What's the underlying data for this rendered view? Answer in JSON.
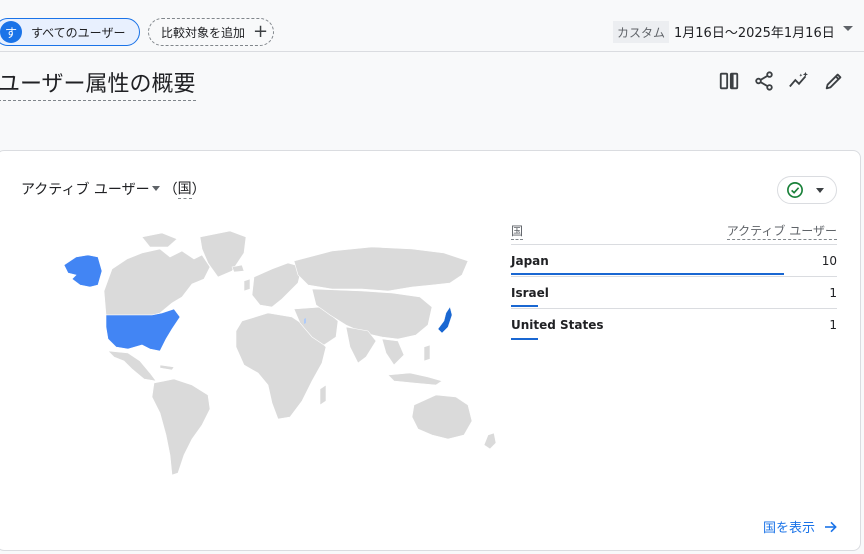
{
  "topbar": {
    "user_chip": {
      "avatar_letter": "す",
      "label": "すべてのユーザー"
    },
    "compare_chip": {
      "label": "比較対象を追加",
      "icon": "plus-icon"
    },
    "date_badge": "カスタム",
    "date_range": "1月16日～2025年1月16日"
  },
  "header": {
    "title": "ユーザー属性の概要",
    "icons": [
      "compare-columns-icon",
      "share-icon",
      "insights-icon",
      "edit-icon"
    ]
  },
  "card": {
    "metric_label": "アクティブ ユーザー",
    "paren_open": "（",
    "dimension_label": "国",
    "paren_close": "）",
    "status_icon": "check-circle-icon",
    "table": {
      "col_dimension": "国",
      "col_metric": "アクティブ ユーザー",
      "rows": [
        {
          "country": "Japan",
          "value": "10",
          "share": 1.0
        },
        {
          "country": "Israel",
          "value": "1",
          "share": 0.1
        },
        {
          "country": "United States",
          "value": "1",
          "share": 0.1
        }
      ]
    },
    "view_link": "国を表示"
  },
  "colors": {
    "accent": "#1a73e8",
    "map_land": "#dadada",
    "map_highlight": "#4285f4",
    "map_strong": "#1967d2",
    "status_green": "#188038"
  }
}
